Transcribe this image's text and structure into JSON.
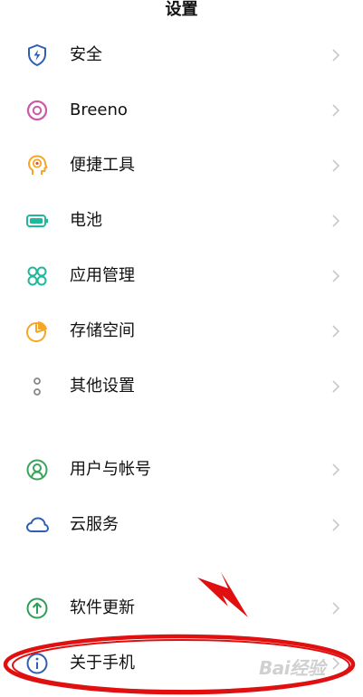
{
  "header": {
    "title": "设置"
  },
  "items": [
    {
      "label": "安全",
      "icon": "shield-lightning-icon",
      "color": "#2f5fb3"
    },
    {
      "label": "Breeno",
      "icon": "breeno-ring-icon",
      "color": "#cc5aa8"
    },
    {
      "label": "便捷工具",
      "icon": "head-gear-icon",
      "color": "#f5a623"
    },
    {
      "label": "电池",
      "icon": "battery-icon",
      "color": "#1fb89a"
    },
    {
      "label": "应用管理",
      "icon": "apps-grid-icon",
      "color": "#1fb89a"
    },
    {
      "label": "存储空间",
      "icon": "pie-chart-icon",
      "color": "#f5a623"
    },
    {
      "label": "其他设置",
      "icon": "more-dots-icon",
      "color": "#888888"
    },
    {
      "label": "用户与帐号",
      "icon": "user-account-icon",
      "color": "#3aa35a"
    },
    {
      "label": "云服务",
      "icon": "cloud-icon",
      "color": "#2f5fb3"
    },
    {
      "label": "软件更新",
      "icon": "update-arrow-icon",
      "color": "#2e9e56"
    },
    {
      "label": "关于手机",
      "icon": "info-icon",
      "color": "#2f5fb3"
    }
  ],
  "annotation": {
    "color": "#e01010"
  },
  "watermark": {
    "text": "Bai经验"
  }
}
